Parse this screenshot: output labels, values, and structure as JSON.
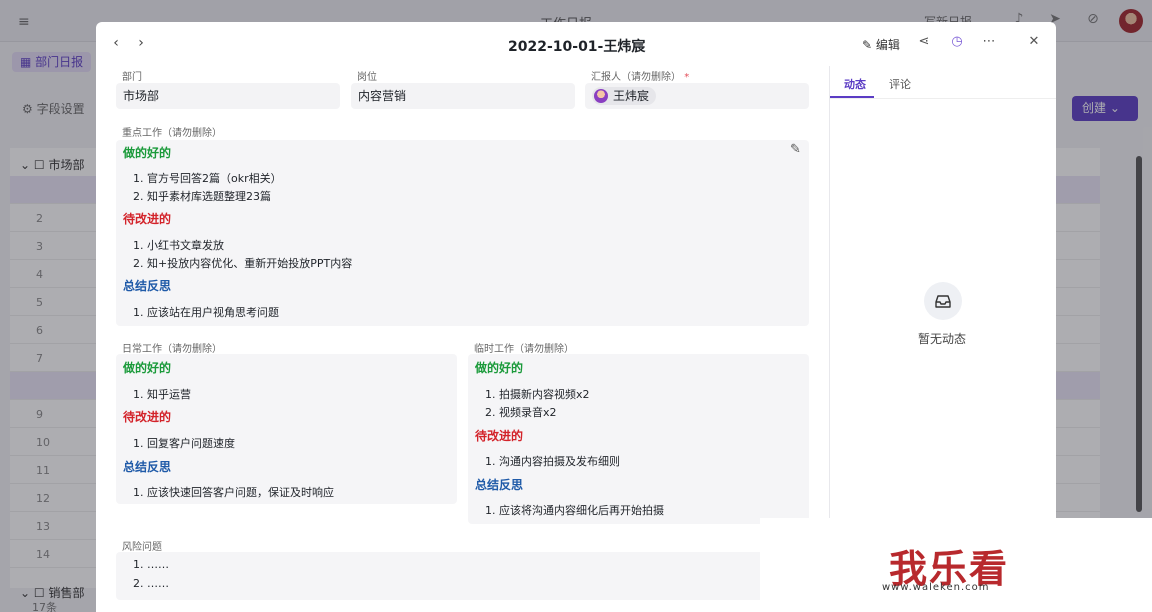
{
  "background": {
    "app_title": "工作日报",
    "report_button": "写新日报",
    "tag_label": "部门日报",
    "field_settings": "字段设置",
    "create_button": "创建",
    "group_1": "市场部",
    "group_2": "销售部",
    "row_numbers": [
      "2",
      "3",
      "4",
      "5",
      "6",
      "7",
      "9",
      "10",
      "11",
      "12",
      "13",
      "14"
    ],
    "footer_count": "17条"
  },
  "modal": {
    "title": "2022-10-01-王炜宸",
    "edit_label": "编辑",
    "fields": {
      "dept_label": "部门",
      "dept_value": "市场部",
      "post_label": "岗位",
      "post_value": "内容营销",
      "reporter_label": "汇报人（请勿删除）",
      "reporter_required": "*",
      "reporter_value": "王炜宸"
    },
    "key_work": {
      "label": "重点工作（请勿删除）",
      "good_title": "做的好的",
      "good_items": [
        "1. 官方号回答2篇（okr相关）",
        "2. 知乎素材库选题整理23篇"
      ],
      "improve_title": "待改进的",
      "improve_items": [
        "1. 小红书文章发放",
        "2. 知+投放内容优化、重新开始投放PPT内容"
      ],
      "summary_title": "总结反思",
      "summary_items": [
        "1. 应该站在用户视角思考问题"
      ]
    },
    "daily_work": {
      "label": "日常工作（请勿删除）",
      "good_title": "做的好的",
      "good_items": [
        "1. 知乎运营"
      ],
      "improve_title": "待改进的",
      "improve_items": [
        "1. 回复客户问题速度"
      ],
      "summary_title": "总结反思",
      "summary_items": [
        "1. 应该快速回答客户问题，保证及时响应"
      ]
    },
    "temp_work": {
      "label": "临时工作（请勿删除）",
      "good_title": "做的好的",
      "good_items": [
        "1. 拍摄新内容视频x2",
        "2. 视频录音x2"
      ],
      "improve_title": "待改进的",
      "improve_items": [
        "1. 沟通内容拍摄及发布细则"
      ],
      "summary_title": "总结反思",
      "summary_items": [
        "1. 应该将沟通内容细化后再开始拍摄"
      ]
    },
    "risk": {
      "label": "风险问题",
      "items": [
        "1. ……",
        "2. ……"
      ]
    },
    "panel": {
      "tab_activity": "动态",
      "tab_comments": "评论",
      "empty_text": "暂无动态"
    }
  },
  "watermark": {
    "main": "我乐看",
    "url": "www.waleken.com"
  },
  "colors": {
    "accent": "#5b3cc4",
    "good": "#1a9a3a",
    "bad": "#d3232a",
    "summary": "#1f5aa8"
  }
}
